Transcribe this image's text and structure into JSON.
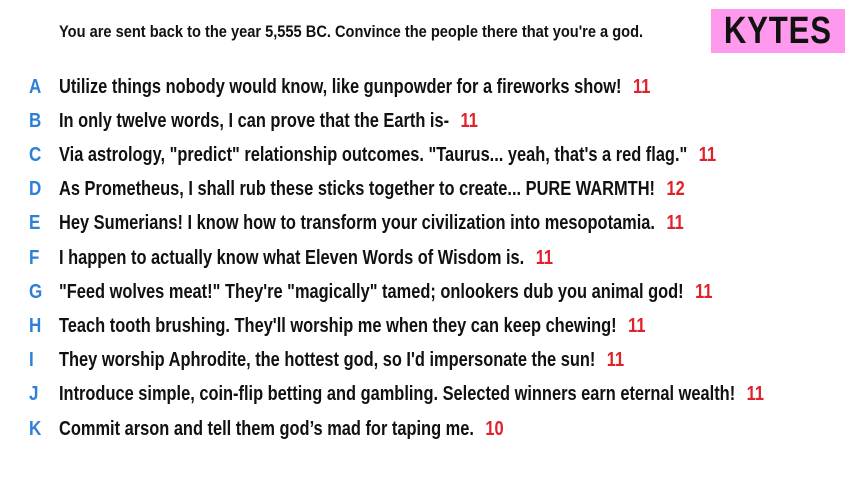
{
  "prompt": "You are sent back to the year 5,555 BC. Convince the people there that you're a god.",
  "brand": "KYTES",
  "colors": {
    "letter": "#2e7fd6",
    "score": "#e0202a",
    "brand_bg": "#ff99ee"
  },
  "entries": [
    {
      "letter": "A",
      "text": "Utilize things nobody would know, like gunpowder for a fireworks show!",
      "score": "11"
    },
    {
      "letter": "B",
      "text": "In only twelve words, I can prove that the Earth is-",
      "score": "11"
    },
    {
      "letter": "C",
      "text": "Via astrology, \"predict\" relationship outcomes. \"Taurus... yeah, that's a red flag.\"",
      "score": "11"
    },
    {
      "letter": "D",
      "text": "As Prometheus, I shall rub these sticks together to create... PURE WARMTH!",
      "score": "12"
    },
    {
      "letter": "E",
      "text": "Hey Sumerians! I know how to transform your civilization into mesopotamia.",
      "score": "11"
    },
    {
      "letter": "F",
      "text": "I happen to actually know what Eleven Words of Wisdom is.",
      "score": "11"
    },
    {
      "letter": "G",
      "text": "\"Feed wolves meat!\" They're \"magically\" tamed; onlookers dub you animal god!",
      "score": "11"
    },
    {
      "letter": "H",
      "text": "Teach tooth brushing. They'll worship me when they can keep chewing!",
      "score": "11"
    },
    {
      "letter": "I",
      "text": "They worship Aphrodite, the hottest god, so I'd impersonate the sun!",
      "score": "11"
    },
    {
      "letter": "J",
      "text": "Introduce simple, coin-flip betting and gambling. Selected winners earn eternal wealth!",
      "score": "11"
    },
    {
      "letter": "K",
      "text": "Commit arson and tell them god’s mad for taping me.",
      "score": "10"
    }
  ]
}
